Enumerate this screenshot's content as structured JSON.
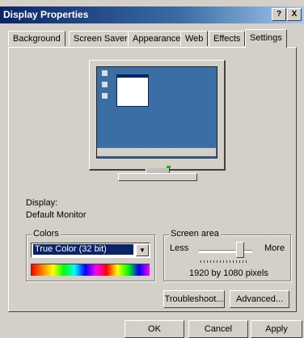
{
  "window": {
    "title": "Display Properties"
  },
  "titlebar_buttons": {
    "help": "?",
    "close": "X"
  },
  "tabs": [
    {
      "label": "Background"
    },
    {
      "label": "Screen Saver"
    },
    {
      "label": "Appearance"
    },
    {
      "label": "Web"
    },
    {
      "label": "Effects"
    },
    {
      "label": "Settings"
    }
  ],
  "active_tab": "Settings",
  "display": {
    "label": "Display:",
    "monitor_name": "Default Monitor"
  },
  "colors": {
    "group_label": "Colors",
    "selected": "True Color (32 bit)"
  },
  "screen_area": {
    "group_label": "Screen area",
    "less_label": "Less",
    "more_label": "More",
    "resolution_text": "1920 by 1080 pixels",
    "slider_level": 0.72
  },
  "buttons": {
    "troubleshoot": "Troubleshoot...",
    "advanced": "Advanced...",
    "ok": "OK",
    "cancel": "Cancel",
    "apply": "Apply"
  },
  "colors_palette": {
    "window_bg": "#d4d0c8",
    "title_blue": "#0a246a",
    "desktop_blue": "#3a6ea5"
  }
}
